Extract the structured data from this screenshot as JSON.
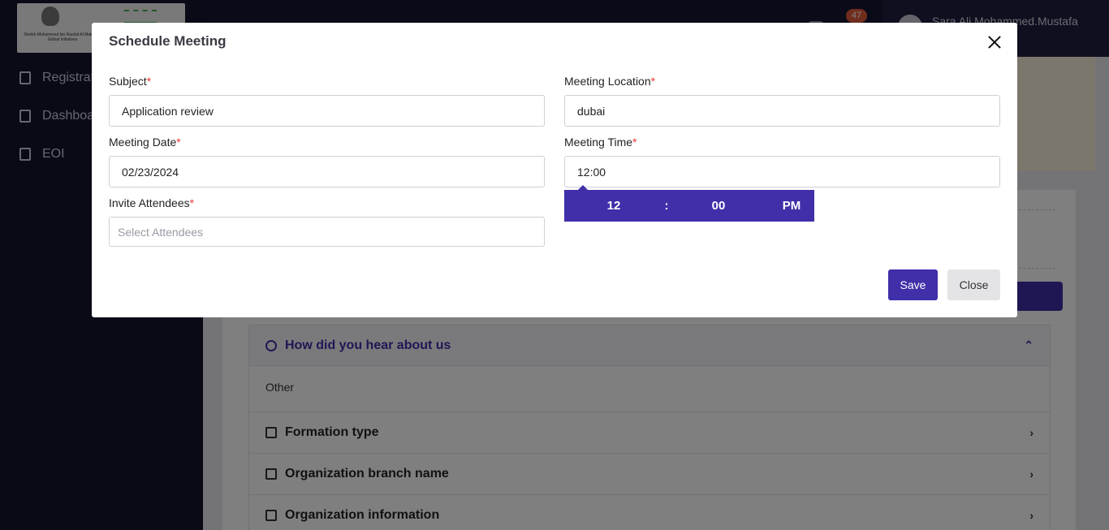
{
  "sidebar": {
    "logo_text": "Sheikh Mohammed bin Rashid Al Maktoum Global Initiatives",
    "items": [
      {
        "label": "Registrat",
        "icon": "clipboard-icon"
      },
      {
        "label": "Dashboa",
        "icon": "document-icon"
      },
      {
        "label": "EOI",
        "icon": "file-icon"
      }
    ]
  },
  "topbar": {
    "notification_count": "47",
    "user_name": "Sara Ali Mohammed.Mustafa"
  },
  "accordion": {
    "sections": [
      {
        "title": "How did you hear about us",
        "value": "Other",
        "open": true
      },
      {
        "title": "Formation type"
      },
      {
        "title": "Organization branch name"
      },
      {
        "title": "Organization information"
      }
    ]
  },
  "modal": {
    "title": "Schedule Meeting",
    "subject_label": "Subject",
    "subject_value": "Application review",
    "location_label": "Meeting Location",
    "location_value": "dubai",
    "date_label": "Meeting Date",
    "date_value": "02/23/2024",
    "time_label": "Meeting Time",
    "time_value": "12:00",
    "attendees_label": "Invite Attendees",
    "attendees_placeholder": "Select Attendees",
    "required_mark": "*",
    "time_picker": {
      "hour": "12",
      "separator": ":",
      "minute": "00",
      "period": "PM"
    },
    "save_label": "Save",
    "close_label": "Close"
  },
  "colors": {
    "accent": "#3f2fa8",
    "required": "#e53935",
    "badge": "#e05a3b"
  }
}
